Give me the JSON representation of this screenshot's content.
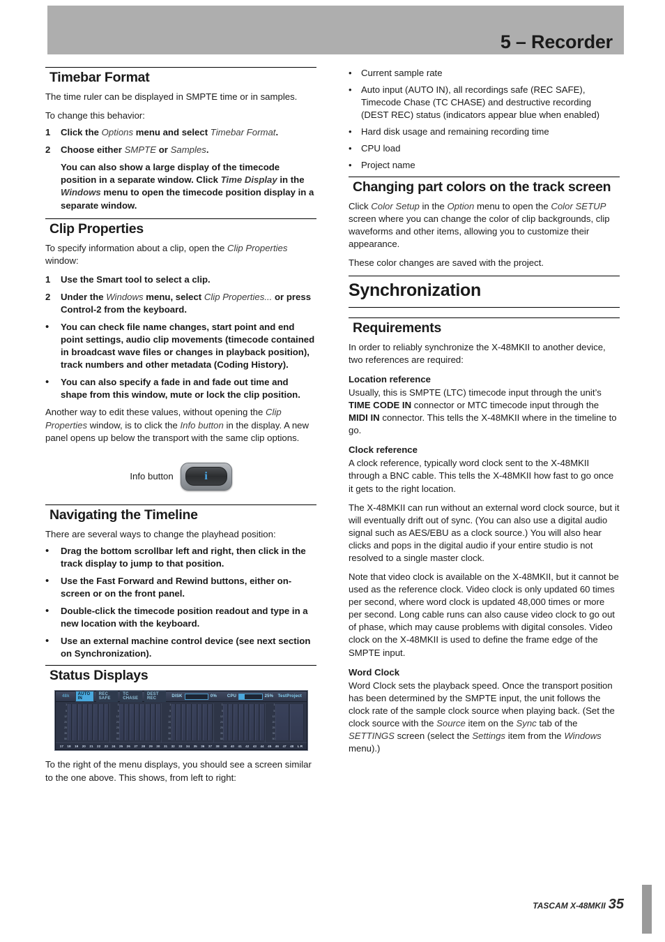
{
  "header": {
    "chapter_title": "5 – Recorder"
  },
  "footer": {
    "product": "TASCAM X-48MKII",
    "page_number": "35"
  },
  "left_column": {
    "timebar": {
      "heading": "Timebar Format",
      "intro": "The time ruler can be displayed in SMPTE time or in samples.",
      "lead": "To change this behavior:",
      "steps": [
        {
          "num": "1",
          "parts": [
            {
              "t": "Click the ",
              "s": "b"
            },
            {
              "t": "Options",
              "s": "i"
            },
            {
              "t": " menu and select ",
              "s": "b"
            },
            {
              "t": "Timebar Format",
              "s": "i"
            },
            {
              "t": ".",
              "s": "b"
            }
          ]
        },
        {
          "num": "2",
          "parts": [
            {
              "t": "Choose either ",
              "s": "b"
            },
            {
              "t": "SMPTE",
              "s": "i"
            },
            {
              "t": " or ",
              "s": "b"
            },
            {
              "t": "Samples",
              "s": "i"
            },
            {
              "t": ".",
              "s": "b"
            }
          ]
        }
      ],
      "note_parts": [
        {
          "t": "You can also show a large display of the timecode position in a separate window. Click ",
          "s": "b"
        },
        {
          "t": "Time Display",
          "s": "i"
        },
        {
          "t": " in the ",
          "s": "b"
        },
        {
          "t": "Windows",
          "s": "i"
        },
        {
          "t": " menu to open the timecode position display in a separate window.",
          "s": "b"
        }
      ]
    },
    "clip_properties": {
      "heading": "Clip Properties",
      "intro_parts": [
        {
          "t": "To specify information about a clip, open the ",
          "s": "n"
        },
        {
          "t": "Clip Properties",
          "s": "i"
        },
        {
          "t": " window:",
          "s": "n"
        }
      ],
      "steps": [
        {
          "num": "1",
          "parts": [
            {
              "t": "Use the Smart tool to select a clip.",
              "s": "b"
            }
          ]
        },
        {
          "num": "2",
          "parts": [
            {
              "t": "Under the ",
              "s": "b"
            },
            {
              "t": "Windows",
              "s": "i"
            },
            {
              "t": " menu, select ",
              "s": "b"
            },
            {
              "t": "Clip Properties...",
              "s": "i"
            },
            {
              "t": " or press Control-2 from the keyboard.",
              "s": "b"
            }
          ]
        },
        {
          "num": "•",
          "parts": [
            {
              "t": "You can check file name changes, start point and end point settings, audio clip movements (timecode contained in broadcast wave files or changes in playback position), track numbers and other metadata (Coding History).",
              "s": "b"
            }
          ]
        },
        {
          "num": "•",
          "parts": [
            {
              "t": "You can also specify a fade in and fade out time and shape from this window, mute or lock the clip position.",
              "s": "b"
            }
          ]
        }
      ],
      "outro_parts": [
        {
          "t": "Another way to edit these values, without opening the ",
          "s": "n"
        },
        {
          "t": "Clip Properties",
          "s": "i"
        },
        {
          "t": " window, is to click the ",
          "s": "n"
        },
        {
          "t": "Info button",
          "s": "i"
        },
        {
          "t": " in the display. A new panel opens up below the transport with the same clip options.",
          "s": "n"
        }
      ],
      "figure": {
        "caption": "Info button",
        "button_glyph": "i"
      }
    },
    "navigating": {
      "heading": "Navigating the Timeline",
      "intro": "There are several ways to change the playhead position:",
      "bullets": [
        "Drag the bottom scrollbar left and right, then click in the track display to jump to that position.",
        "Use the Fast Forward and Rewind buttons, either on-screen or on the front panel.",
        "Double-click the timecode position readout and type in a new location with the keyboard.",
        "Use an external machine control device (see next section on Synchronization)."
      ]
    },
    "status_displays": {
      "heading": "Status Displays",
      "outro": "To the right of the menu displays, you should see a screen similar to the one above. This shows, from left to right:",
      "screen": {
        "sample_rate": "48k",
        "indicators": [
          {
            "label": "AUTO IN",
            "active": true
          },
          {
            "label": "REC SAFE",
            "active": false
          },
          {
            "label": "TC CHASE",
            "active": false
          },
          {
            "label": "DEST REC",
            "active": false
          }
        ],
        "disk_label": "DISK",
        "disk_percent": "0%",
        "disk_fill": 0,
        "cpu_label": "CPU",
        "cpu_percent": "25%",
        "cpu_fill": 25,
        "project_name": "TestProject",
        "scale_ticks": [
          "1",
          "5",
          "12",
          "20",
          "25",
          "35",
          "50"
        ],
        "track_numbers": [
          "17",
          "18",
          "19",
          "20",
          "21",
          "22",
          "23",
          "24",
          "25",
          "26",
          "27",
          "28",
          "29",
          "30",
          "31",
          "32",
          "33",
          "34",
          "35",
          "36",
          "37",
          "38",
          "39",
          "40",
          "41",
          "42",
          "43",
          "44",
          "45",
          "46",
          "47",
          "48",
          "L R"
        ],
        "accent_color": "#49a8dd",
        "background_color": "#2e3547"
      }
    }
  },
  "right_column": {
    "status_list": [
      "Current sample rate",
      "Auto input (AUTO IN), all recordings safe (REC SAFE), Timecode Chase (TC CHASE) and destructive recording (DEST REC) status (indicators appear blue when enabled)",
      "Hard disk usage and remaining recording time",
      "CPU load",
      "Project name"
    ],
    "part_colors": {
      "heading": "Changing part colors on the track screen",
      "body_parts": [
        {
          "t": "Click ",
          "s": "n"
        },
        {
          "t": "Color Setup",
          "s": "i"
        },
        {
          "t": " in the ",
          "s": "n"
        },
        {
          "t": "Option",
          "s": "i"
        },
        {
          "t": " menu to open the ",
          "s": "n"
        },
        {
          "t": "Color SETUP",
          "s": "i"
        },
        {
          "t": " screen where you can change the color of clip backgrounds, clip waveforms and other items, allowing you to customize their appearance.",
          "s": "n"
        }
      ],
      "body2": "These color changes are saved with the project."
    },
    "synchronization": {
      "heading": "Synchronization",
      "requirements": {
        "heading": "Requirements",
        "intro": "In order to reliably synchronize the X-48MKII to another device, two references are required:",
        "location": {
          "heading": "Location reference",
          "parts": [
            {
              "t": "Usually, this is SMPTE (LTC) timecode input through the unit’s ",
              "s": "n"
            },
            {
              "t": "TIME CODE IN",
              "s": "b"
            },
            {
              "t": " connector or MTC timecode input through the ",
              "s": "n"
            },
            {
              "t": "MIDI IN",
              "s": "b"
            },
            {
              "t": " connector.  This tells the X-48MKII where in the timeline to go.",
              "s": "n"
            }
          ]
        },
        "clock": {
          "heading": "Clock reference",
          "p1": "A clock reference, typically word clock sent to the X-48MKII through a BNC cable. This tells the X-48MKII how fast to go once it gets to the right location.",
          "p2": "The X-48MKII can run without an external word clock source, but it will eventually drift out of sync. (You can also use a digital audio signal such as AES/EBU as a clock source.) You will also hear clicks and pops in the digital audio if your entire studio is not resolved to a single master clock.",
          "p3": "Note that video clock is available on the X-48MKII, but it cannot be used as the reference clock. Video clock is only updated 60 times per second, where word clock is updated 48,000 times or more per second. Long cable runs can also cause video clock to go out of phase, which may cause problems with digital consoles. Video clock on the X-48MKII is used to define the frame edge of the SMPTE input."
        },
        "word_clock": {
          "heading": "Word Clock",
          "parts": [
            {
              "t": "Word Clock sets the playback speed. Once the transport position has been determined by the SMPTE input, the unit follows the clock rate of the sample clock source when playing back. (Set the clock source with the ",
              "s": "n"
            },
            {
              "t": "Source",
              "s": "i"
            },
            {
              "t": " item on the ",
              "s": "n"
            },
            {
              "t": "Sync",
              "s": "i"
            },
            {
              "t": " tab of the ",
              "s": "n"
            },
            {
              "t": "SETTINGS",
              "s": "i"
            },
            {
              "t": " screen (select the ",
              "s": "n"
            },
            {
              "t": "Settings",
              "s": "i"
            },
            {
              "t": " item from the ",
              "s": "n"
            },
            {
              "t": "Windows",
              "s": "i"
            },
            {
              "t": " menu).)",
              "s": "n"
            }
          ]
        }
      }
    }
  }
}
